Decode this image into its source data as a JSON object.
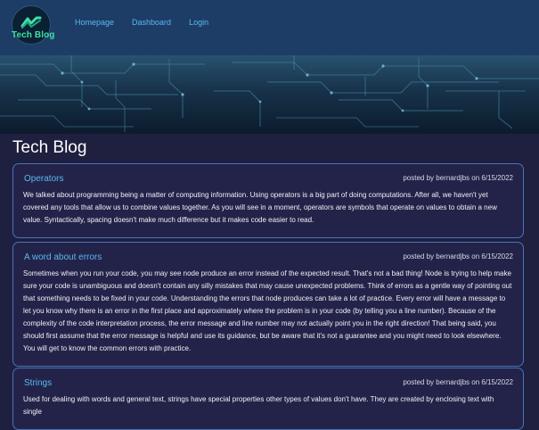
{
  "nav": {
    "logo_text": "Tech Blog",
    "links": [
      "Homepage",
      "Dashboard",
      "Login"
    ]
  },
  "page_title": "Tech Blog",
  "posts": [
    {
      "title": "Operators",
      "meta": "posted by bernardjbs on 6/15/2022",
      "body": "We talked about programming being a matter of computing information. Using operators is a big part of doing computations. After all, we haven't yet covered any tools that allow us to combine values together. As you will see in a moment, operators are symbols that operate on values to obtain a new value. Syntactically, spacing doesn't make much difference but it makes code easier to read."
    },
    {
      "title": "A word about errors",
      "meta": "posted by bernardjbs on 6/15/2022",
      "body": "Sometimes when you run your code, you may see node produce an error instead of the expected result. That's not a bad thing! Node is trying to help make sure your code is unambiguous and doesn't contain any silly mistakes that may cause unexpected problems. Think of errors as a gentle way of pointing out that something needs to be fixed in your code. Understanding the errors that node produces can take a lot of practice. Every error will have a message to let you know why there is an error in the first place and approximately where the problem is in your code (by telling you a line number). Because of the complexity of the code interpretation process, the error message and line number may not actually point you in the right direction! That being said, you should first assume that the error message is helpful and use its guidance, but be aware that it's not a guarantee and you might need to look elsewhere. You will get to know the common errors with practice."
    },
    {
      "title": "Strings",
      "meta": "posted by bernardjbs on 6/15/2022",
      "body": "Used for dealing with words and general text, strings have special properties other types of values don't have. They are created by enclosing text with single"
    }
  ],
  "colors": {
    "background": "#1f1f3f",
    "nav": "#1d3c66",
    "link": "#5ab8f0",
    "card_border": "#4a73b8",
    "logo_accent": "#3fe0a9"
  }
}
